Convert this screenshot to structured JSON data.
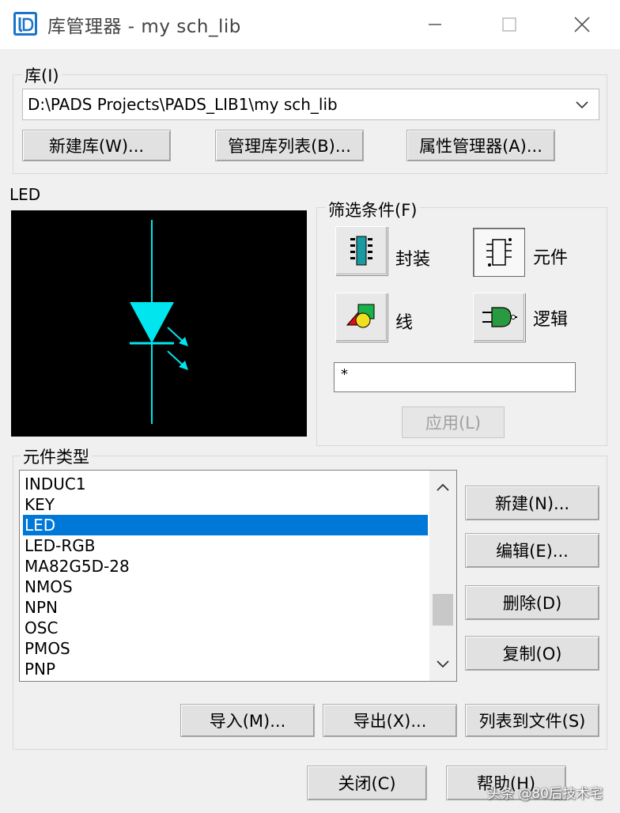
{
  "window": {
    "title": "库管理器 - my sch_lib"
  },
  "library_group": {
    "label": "库(I)",
    "path": "D:\\PADS Projects\\PADS_LIB1\\my sch_lib",
    "new_lib_button": "新建库(W)...",
    "manage_list_button": "管理库列表(B)...",
    "attr_manager_button": "属性管理器(A)..."
  },
  "preview": {
    "label": "LED",
    "symbol_color": "#00e5ee"
  },
  "filter_group": {
    "label": "筛选条件(F)",
    "items": [
      {
        "label": "封装",
        "icon": "decal-icon",
        "pressed": false
      },
      {
        "label": "元件",
        "icon": "part-icon",
        "pressed": true
      },
      {
        "label": "线",
        "icon": "lines-icon",
        "pressed": false
      },
      {
        "label": "逻辑",
        "icon": "logic-icon",
        "pressed": false
      }
    ],
    "input_value": "*",
    "apply_button": "应用(L)"
  },
  "part_types": {
    "label": "元件类型",
    "items": [
      "INDUC1",
      "KEY",
      "LED",
      "LED-RGB",
      "MA82G5D-28",
      "NMOS",
      "NPN",
      "OSC",
      "PMOS",
      "PNP"
    ],
    "selected_index": 2,
    "selection_color": "#0078d7",
    "new_button": "新建(N)...",
    "edit_button": "编辑(E)...",
    "delete_button": "删除(D)",
    "copy_button": "复制(O)"
  },
  "bottom": {
    "import_button": "导入(M)...",
    "export_button": "导出(X)...",
    "list_to_file_button": "列表到文件(S)",
    "close_button": "关闭(C)",
    "help_button": "帮助(H)"
  },
  "watermark": "头条 @80后技术宅"
}
